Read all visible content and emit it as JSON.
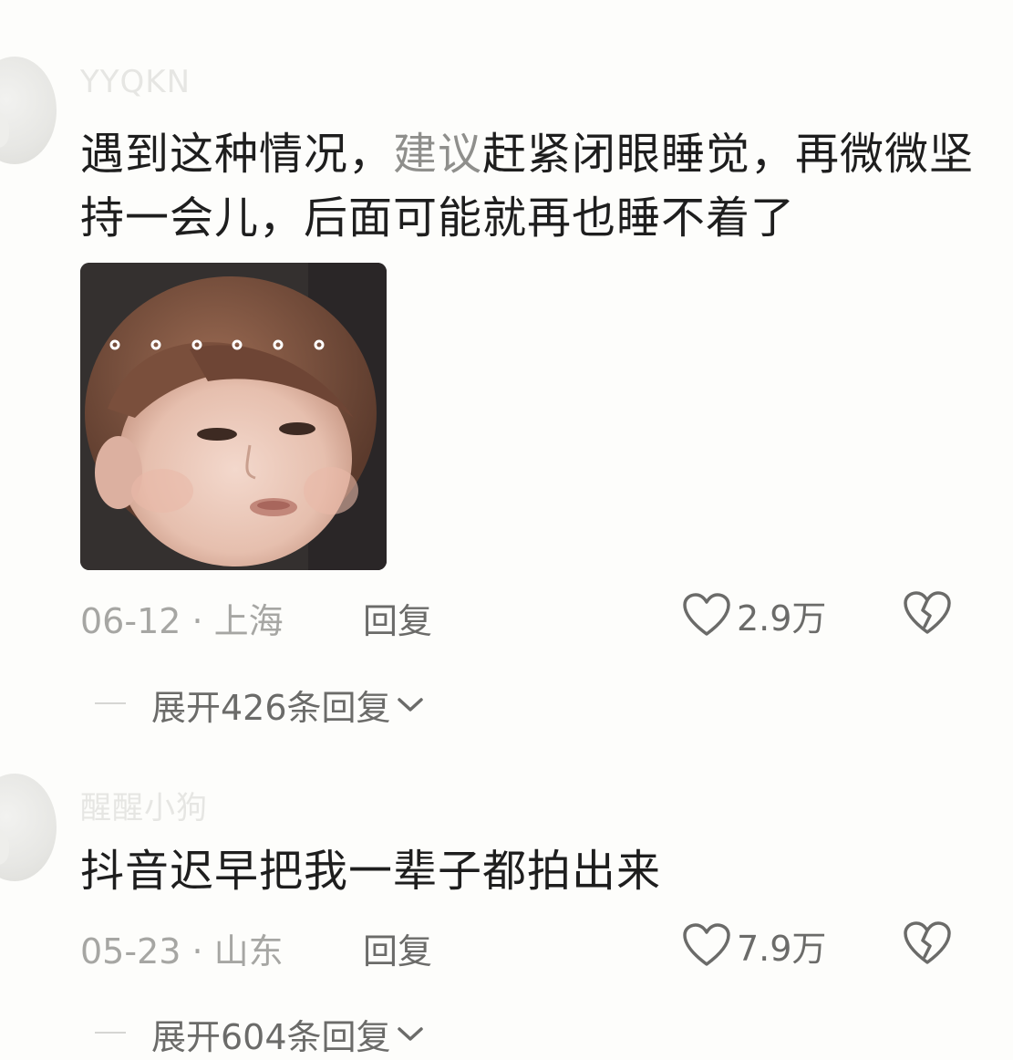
{
  "comments": [
    {
      "username": "YYQKN",
      "text_before": "遇到这种情况，",
      "text_faded": "建议",
      "text_after": "赶紧闭眼睡觉，再微微坚持一会儿，后面可能就再也睡不着了",
      "date_location": "06-12 · 上海",
      "reply_label": "回复",
      "likes": "2.9万",
      "expand_label": "展开426条回复",
      "sticker_dots": "o o o o o o"
    },
    {
      "username": "醒醒小狗",
      "text": "抖音迟早把我一辈子都拍出来",
      "date_location": "05-23 · 山东",
      "reply_label": "回复",
      "likes": "7.9万",
      "expand_label": "展开604条回复"
    }
  ],
  "icons": {
    "like": "heart-outline-icon",
    "dislike": "broken-heart-icon",
    "expand": "chevron-down-icon"
  },
  "colors": {
    "background": "#fdfdfb",
    "text": "#1e1e1e",
    "muted": "#a6a6a3",
    "action": "#6b6b69"
  }
}
